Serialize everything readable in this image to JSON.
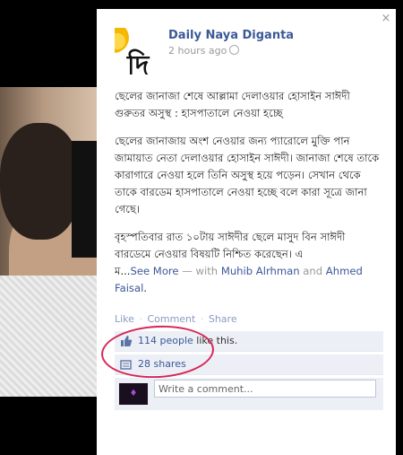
{
  "post": {
    "page_name": "Daily Naya Diganta",
    "time": "2 hours ago",
    "paragraphs": [
      "ছেলের জানাজা শেষে আল্লামা দেলাওয়ার হোসাইন সাঈদী গুরুতর অসুস্থ : হাসপাতালে নেওয়া হচ্ছে",
      "ছেলের জানাজায় অংশ নেওয়ার জন্য প্যারোলে মুক্তি পান জামায়াত নেতা দেলাওয়ার হোসাইন সাঈদী। জানাজা শেষে তাকে কারাগারে নেওয়া হলে তিনি অসুস্থ হয়ে পড়েন। সেখান থেকে তাকে বারডেম হাসপাতালে নেওয়া হচ্ছে বলে কারা সূত্রে জানা গেছে।",
      "বৃহস্পতিবার রাত ১০টায় সাঈদীর ছেলে মাসুদ বিন সাঈদী বারডেমে নেওয়ার বিষয়টি নিশ্চিত করেছেন। এ"
    ],
    "last_line_prefix": "ম...",
    "see_more": "See More",
    "with_text": "— with",
    "tag1": "Muhib Alrhman",
    "and_text": "and",
    "tag2": "Ahmed Faisal",
    "period": "."
  },
  "actions": {
    "like": "Like",
    "comment": "Comment",
    "share": "Share",
    "sep": "·"
  },
  "likes": {
    "people": "114 people",
    "suffix": "like this."
  },
  "shares": {
    "label": "28 shares"
  },
  "comment": {
    "placeholder": "Write a comment..."
  },
  "close_symbol": "×",
  "avatar_glyph": "দি",
  "icons": {
    "close": "close-icon",
    "globe": "globe-icon",
    "like": "thumbs-up-icon",
    "share": "share-icon"
  },
  "colors": {
    "link": "#3b5998",
    "highlight": "#d62657",
    "row_bg": "#eceff5"
  }
}
